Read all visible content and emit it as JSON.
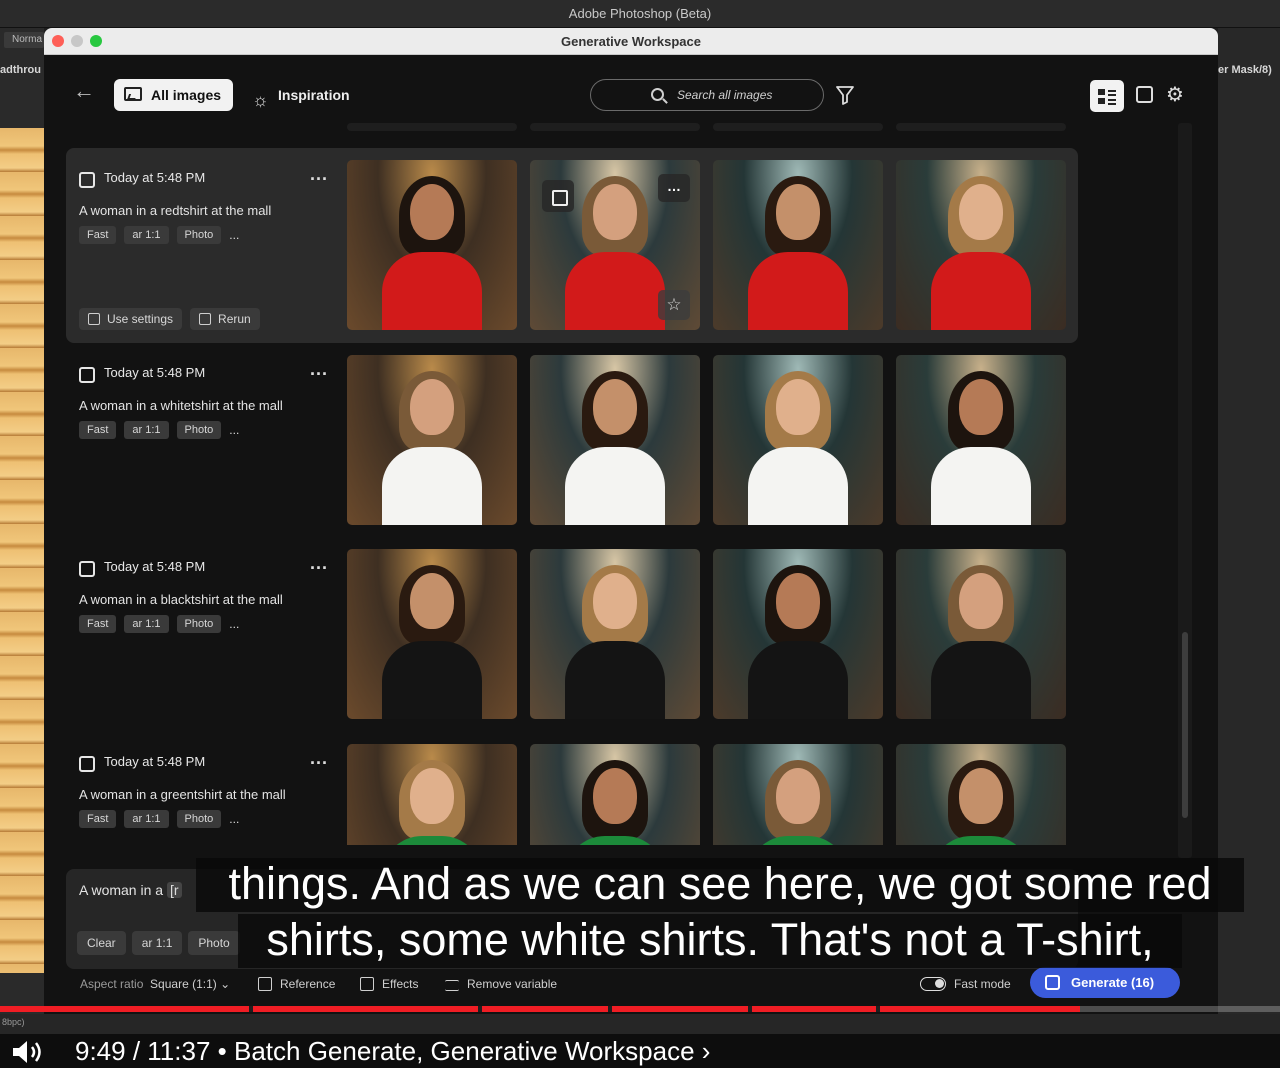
{
  "app": {
    "title": "Adobe Photoshop (Beta)",
    "left_tag": "Norma",
    "left_label": "adthrou",
    "right_label": "er Mask/8)",
    "bottom_label": "8bpc)"
  },
  "window": {
    "title": "Generative Workspace"
  },
  "toolbar": {
    "all_images_label": "All images",
    "inspiration_label": "Inspiration",
    "search_placeholder": "Search all images",
    "icons": [
      "back-arrow-icon",
      "image-icon",
      "lightbulb-icon",
      "search-icon",
      "filter-icon",
      "grid-view-icon",
      "single-view-icon",
      "gear-icon"
    ]
  },
  "groups": [
    {
      "timestamp": "Today at 5:48 PM",
      "prompt": "A woman in a redtshirt at the mall",
      "tags": [
        "Fast",
        "ar 1:1",
        "Photo"
      ],
      "more": "...",
      "actions": [
        "Use settings",
        "Rerun"
      ],
      "selected": true,
      "shirt_color": "#d21a1a"
    },
    {
      "timestamp": "Today at 5:48 PM",
      "prompt": "A woman in a whitetshirt at the mall",
      "tags": [
        "Fast",
        "ar 1:1",
        "Photo"
      ],
      "more": "...",
      "selected": false,
      "shirt_color": "#f4f4f2"
    },
    {
      "timestamp": "Today at 5:48 PM",
      "prompt": "A woman in a blacktshirt at the mall",
      "tags": [
        "Fast",
        "ar 1:1",
        "Photo"
      ],
      "more": "...",
      "selected": false,
      "shirt_color": "#141414"
    },
    {
      "timestamp": "Today at 5:48 PM",
      "prompt": "A woman in a greentshirt at the mall",
      "tags": [
        "Fast",
        "ar 1:1",
        "Photo"
      ],
      "more": "...",
      "selected": false,
      "shirt_color": "#1c8a3a"
    }
  ],
  "prompt_panel": {
    "prefix": "A woman in a",
    "variable_visible": "[r",
    "chips": [
      "Clear",
      "ar 1:1",
      "Photo"
    ]
  },
  "bottom_bar": {
    "aspect_label": "Aspect ratio",
    "aspect_value": "Square (1:1)",
    "reference_label": "Reference",
    "effects_label": "Effects",
    "remove_variable_label": "Remove variable",
    "fast_mode_label": "Fast mode",
    "fast_mode_on": true,
    "generate_label": "Generate (16)"
  },
  "subtitles": {
    "line1": "things. And as we can see here, we got some red",
    "line2": "shirts, some white shirts. That's not a T-shirt,"
  },
  "video": {
    "time": "9:49 / 11:37",
    "separator": "•",
    "chapter": "Batch Generate, Generative Workspace",
    "chevron": "›",
    "progress_fraction": 0.844
  },
  "colors": {
    "accent": "#3b5bdb",
    "progress": "#f01d24",
    "window_bg": "#121212"
  }
}
